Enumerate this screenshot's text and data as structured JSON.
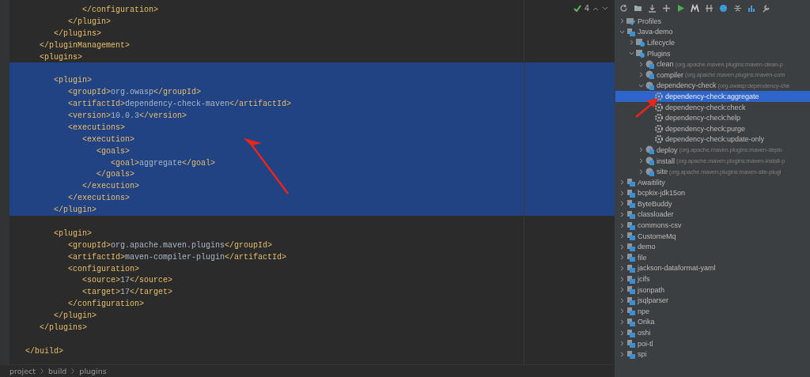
{
  "editor": {
    "lines": [
      {
        "text": "            </configuration>",
        "selected": false
      },
      {
        "text": "         </plugin>",
        "selected": false
      },
      {
        "text": "      </plugins>",
        "selected": false
      },
      {
        "text": "   </pluginManagement>",
        "selected": false
      },
      {
        "text": "   <plugins>",
        "selected": false
      },
      {
        "selected": true
      },
      {
        "text": "      <plugin>",
        "selected": true
      },
      {
        "text": "         <groupId>org.owasp</groupId>",
        "selected": true
      },
      {
        "text": "         <artifactId>dependency-check-maven</artifactId>",
        "selected": true
      },
      {
        "text": "         <version>10.0.3</version>",
        "selected": true
      },
      {
        "text": "         <executions>",
        "selected": true
      },
      {
        "text": "            <execution>",
        "selected": true
      },
      {
        "text": "               <goals>",
        "selected": true
      },
      {
        "text": "                  <goal>aggregate</goal>",
        "selected": true
      },
      {
        "text": "               </goals>",
        "selected": true
      },
      {
        "text": "            </execution>",
        "selected": true
      },
      {
        "text": "         </executions>",
        "selected": true
      },
      {
        "text": "      </plugin>",
        "selected": true
      },
      {
        "selected": false
      },
      {
        "text": "      <plugin>",
        "selected": false
      },
      {
        "text": "         <groupId>org.apache.maven.plugins</groupId>",
        "selected": false
      },
      {
        "text": "         <artifactId>maven-compiler-plugin</artifactId>",
        "selected": false
      },
      {
        "text": "         <configuration>",
        "selected": false
      },
      {
        "text": "            <source>17</source>",
        "selected": false
      },
      {
        "text": "            <target>17</target>",
        "selected": false
      },
      {
        "text": "         </configuration>",
        "selected": false
      },
      {
        "text": "      </plugin>",
        "selected": false
      },
      {
        "text": "   </plugins>",
        "selected": false
      },
      {
        "selected": false
      },
      {
        "text": "</build>",
        "selected": false
      }
    ],
    "inspection_count": "4",
    "breadcrumbs": [
      "project",
      "build",
      "plugins"
    ]
  },
  "maven_panel": {
    "tree": [
      {
        "label": "Profiles",
        "kind": "profiles",
        "expanded": false,
        "selected": false
      },
      {
        "label": "Java-demo",
        "kind": "project",
        "expanded": true,
        "selected": false,
        "children": [
          {
            "label": "Lifecycle",
            "kind": "folder",
            "expanded": false,
            "selected": false
          },
          {
            "label": "Plugins",
            "kind": "folder",
            "expanded": true,
            "selected": false,
            "children": [
              {
                "label": "clean",
                "detail": "(org.apache.maven.plugins:maven-clean-p",
                "kind": "plugin",
                "expanded": false,
                "selected": false
              },
              {
                "label": "compiler",
                "detail": "(org.apache.maven.plugins:maven-com",
                "kind": "plugin",
                "expanded": false,
                "selected": false
              },
              {
                "label": "dependency-check",
                "detail": "(org.owasp:dependency-che",
                "kind": "plugin",
                "expanded": true,
                "selected": false,
                "children": [
                  {
                    "label": "dependency-check:aggregate",
                    "kind": "goal",
                    "selected": true
                  },
                  {
                    "label": "dependency-check:check",
                    "kind": "goal",
                    "selected": false
                  },
                  {
                    "label": "dependency-check:help",
                    "kind": "goal",
                    "selected": false
                  },
                  {
                    "label": "dependency-check:purge",
                    "kind": "goal",
                    "selected": false
                  },
                  {
                    "label": "dependency-check:update-only",
                    "kind": "goal",
                    "selected": false
                  }
                ]
              },
              {
                "label": "deploy",
                "detail": "(org.apache.maven.plugins:maven-deplo",
                "kind": "plugin",
                "expanded": false,
                "selected": false
              },
              {
                "label": "install",
                "detail": "(org.apache.maven.plugins:maven-install-p",
                "kind": "plugin",
                "expanded": false,
                "selected": false
              },
              {
                "label": "site",
                "detail": "(org.apache.maven.plugins:maven-site-plugi",
                "kind": "plugin",
                "expanded": false,
                "selected": false
              }
            ]
          }
        ]
      },
      {
        "label": "Awaitility",
        "kind": "project",
        "expanded": false,
        "selected": false
      },
      {
        "label": "bcpkix-jdk15on",
        "kind": "project",
        "expanded": false,
        "selected": false
      },
      {
        "label": "ByteBuddy",
        "kind": "project",
        "expanded": false,
        "selected": false
      },
      {
        "label": "classloader",
        "kind": "project",
        "expanded": false,
        "selected": false
      },
      {
        "label": "commons-csv",
        "kind": "project",
        "expanded": false,
        "selected": false
      },
      {
        "label": "CustomeMq",
        "kind": "project",
        "expanded": false,
        "selected": false
      },
      {
        "label": "demo",
        "kind": "project",
        "expanded": false,
        "selected": false
      },
      {
        "label": "file",
        "kind": "project",
        "expanded": false,
        "selected": false
      },
      {
        "label": "jackson-dataformat-yaml",
        "kind": "project",
        "expanded": false,
        "selected": false
      },
      {
        "label": "jcifs",
        "kind": "project",
        "expanded": false,
        "selected": false
      },
      {
        "label": "jsonpath",
        "kind": "project",
        "expanded": false,
        "selected": false
      },
      {
        "label": "jsqlparser",
        "kind": "project",
        "expanded": false,
        "selected": false
      },
      {
        "label": "npe",
        "kind": "project",
        "expanded": false,
        "selected": false
      },
      {
        "label": "Orika",
        "kind": "project",
        "expanded": false,
        "selected": false
      },
      {
        "label": "oshi",
        "kind": "project",
        "expanded": false,
        "selected": false
      },
      {
        "label": "poi-tl",
        "kind": "project",
        "expanded": false,
        "selected": false
      },
      {
        "label": "spi",
        "kind": "project",
        "expanded": false,
        "selected": false
      }
    ]
  }
}
